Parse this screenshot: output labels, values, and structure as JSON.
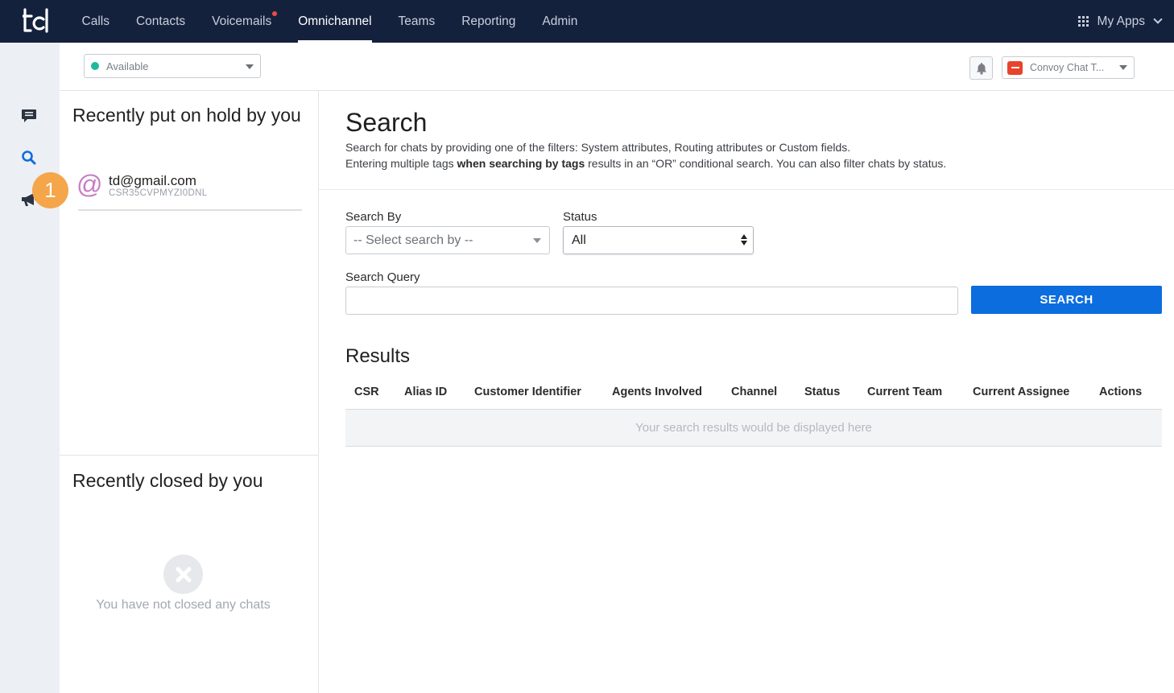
{
  "nav": {
    "logo": "td",
    "items": [
      {
        "label": "Calls"
      },
      {
        "label": "Contacts"
      },
      {
        "label": "Voicemails"
      },
      {
        "label": "Omnichannel"
      },
      {
        "label": "Teams"
      },
      {
        "label": "Reporting"
      },
      {
        "label": "Admin"
      }
    ],
    "active_item": "Omnichannel",
    "notification_dot_on": "Voicemails",
    "my_apps_label": "My Apps"
  },
  "rail": {
    "icons": [
      "chat-icon",
      "search-icon",
      "megaphone-icon"
    ],
    "active": "search-icon",
    "step_badge": "1"
  },
  "subheader": {
    "availability": "Available",
    "availability_color": "#1fb99b",
    "inbox_selector": "Convoy Chat T..."
  },
  "left_panel": {
    "hold_title": "Recently put on hold by you",
    "hold_items": [
      {
        "email": "td@gmail.com",
        "csr": "CSR35CVPMYZI0DNL"
      }
    ],
    "closed_title": "Recently closed by you",
    "closed_empty": "You have not closed any chats"
  },
  "main": {
    "title": "Search",
    "description_line1": "Search for chats by providing one of the filters: System attributes, Routing attributes or Custom fields.",
    "description_line2_pre": "Entering multiple tags ",
    "description_line2_bold": "when searching by tags",
    "description_line2_post": " results in an “OR” conditional search. You can also filter chats by status.",
    "search_by_label": "Search By",
    "search_by_value": "-- Select search by --",
    "status_label": "Status",
    "status_value": "All",
    "query_label": "Search Query",
    "query_value": "",
    "search_button": "SEARCH",
    "results_title": "Results",
    "columns": [
      "CSR",
      "Alias ID",
      "Customer Identifier",
      "Agents Involved",
      "Channel",
      "Status",
      "Current Team",
      "Current Assignee",
      "Actions"
    ],
    "empty_results": "Your search results would be displayed here"
  },
  "colors": {
    "topbar": "#14213d",
    "primary": "#0c6ddf",
    "badge": "#f5a54a"
  }
}
